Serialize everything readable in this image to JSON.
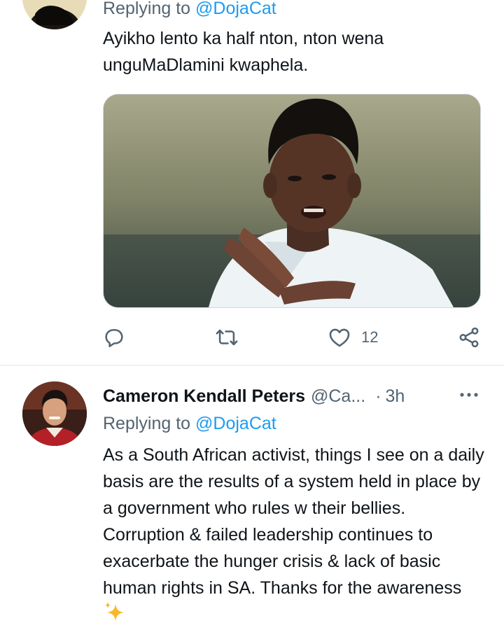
{
  "tweet1": {
    "replying_label": "Replying to",
    "replying_handle": "@DojaCat",
    "text": "Ayikho lento ka half nton, nton wena unguMaDlamini kwaphela.",
    "media": "photo of a man in a white shirt making a crossed-hands gesture",
    "actions": {
      "reply_icon": "reply-icon",
      "retweet_icon": "retweet-icon",
      "like_icon": "heart-icon",
      "like_count": "12",
      "share_icon": "share-icon"
    }
  },
  "tweet2": {
    "author_name": "Cameron Kendall Peters",
    "author_handle": "@Ca...",
    "separator": "·",
    "time": "3h",
    "more_icon": "more-dots-icon",
    "replying_label": "Replying to",
    "replying_handle": "@DojaCat",
    "text": "As a South African activist, things I see on a daily basis are the results of a system held in place by a government who rules w their bellies. Corruption & failed leadership continues to exacerbate the hunger crisis & lack of basic human rights in SA. Thanks for the awareness"
  },
  "colors": {
    "link": "#1d9bf0",
    "secondary_text": "#536471",
    "primary_text": "#0f1419",
    "divider": "#eff3f4"
  }
}
